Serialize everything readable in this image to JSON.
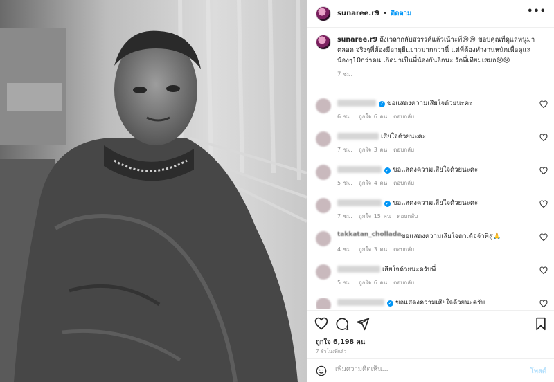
{
  "post": {
    "username": "sunaree.r9",
    "follow_label": "ติดตาม",
    "more_label": "•••",
    "caption_username": "sunaree.r9",
    "caption_text": "ถึงเวลากลับสวรรค์แล้วเน้าะพี่😢😢 ขอบคุณที่ดูแลหนูมาตลอด จริงๆพี่ต้องมีอายุยืนยาวมากกว่านี้ แต่พี่ต้องทำงานหนักเพื่อดูแลน้องๆ10กว่าคน เกิดมาเป็นพี่น้องกันอีกนะ รักพี่เทียมเสมอ😢😢",
    "caption_time": "7 ชม.",
    "likes": "ถูกใจ 6,198 คน",
    "posted_ago": "7 ชั่วโมงที่แล้ว",
    "comment_placeholder": "เพิ่มความคิดเห็น...",
    "post_button_label": "โพสต์"
  },
  "comments": [
    {
      "text": "ขอแสดงความเสียใจด้วยนะคะ",
      "verified": true,
      "time": "6 ชม.",
      "likes": "ถูกใจ 6 คน",
      "reply": "ตอบกลับ"
    },
    {
      "text": "เสียใจด้วยนะคะ",
      "verified": false,
      "time": "7 ชม.",
      "likes": "ถูกใจ 3 คน",
      "reply": "ตอบกลับ"
    },
    {
      "text": "ขอแสดงความเสียใจด้วยนะคะ",
      "verified": true,
      "time": "5 ชม.",
      "likes": "ถูกใจ 4 คน",
      "reply": "ตอบกลับ"
    },
    {
      "text": "ขอแสดงความเสียใจด้วยนะคะ",
      "verified": true,
      "time": "7 ชม.",
      "likes": "ถูกใจ 15 คน",
      "reply": "ตอบกลับ"
    },
    {
      "name": "takkatan_chollada",
      "text": "ขอแสดงความเสียใจดาเด้อจ้าพี่สู🙏",
      "verified": false,
      "time": "4 ชม.",
      "likes": "ถูกใจ 3 คน",
      "reply": "ตอบกลับ"
    },
    {
      "text": "เสียใจด้วยนะครับพี่",
      "verified": false,
      "time": "5 ชม.",
      "likes": "ถูกใจ 6 คน",
      "reply": "ตอบกลับ"
    },
    {
      "text": "ขอแสดงความเสียใจด้วยนะครับ",
      "verified": true,
      "time": "",
      "likes": "",
      "reply": ""
    }
  ],
  "colors": {
    "link_blue": "#0095f6",
    "muted": "#8e8e8e",
    "border": "#efefef"
  },
  "icons": [
    "more-icon",
    "heart-icon",
    "comment-icon",
    "share-icon",
    "bookmark-icon",
    "emoji-icon",
    "verified-icon"
  ]
}
